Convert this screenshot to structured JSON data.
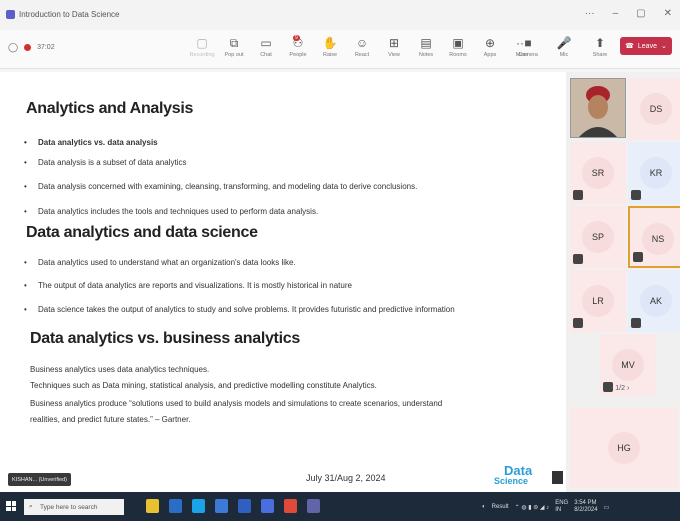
{
  "window": {
    "title": "Introduction to Data Science",
    "controls": [
      "···",
      "–",
      "▢",
      "✕"
    ]
  },
  "meeting": {
    "timer": "37:02",
    "tools": [
      {
        "name": "recording-icon",
        "glyph": "▢",
        "label": "Recording"
      },
      {
        "name": "pop-out-icon",
        "glyph": "⧉",
        "label": "Pop out"
      },
      {
        "name": "chat-icon",
        "glyph": "▭",
        "label": "Chat"
      },
      {
        "name": "people-icon",
        "glyph": "⚇",
        "label": "People"
      },
      {
        "name": "raise-hand-icon",
        "glyph": "✋",
        "label": "Raise"
      },
      {
        "name": "react-icon",
        "glyph": "☺",
        "label": "React"
      },
      {
        "name": "view-icon",
        "glyph": "⊞",
        "label": "View"
      },
      {
        "name": "notes-icon",
        "glyph": "▤",
        "label": "Notes"
      },
      {
        "name": "rooms-icon",
        "glyph": "▣",
        "label": "Rooms"
      },
      {
        "name": "apps-icon",
        "glyph": "⊕",
        "label": "Apps"
      },
      {
        "name": "more-icon",
        "glyph": "···",
        "label": "More"
      }
    ],
    "people_badge": "9",
    "right_tools": [
      {
        "name": "camera-icon",
        "glyph": "■",
        "label": "Camera"
      },
      {
        "name": "mic-icon",
        "glyph": "🎤",
        "label": "Mic"
      },
      {
        "name": "share-icon",
        "glyph": "⬆",
        "label": "Share"
      }
    ],
    "leave_label": "Leave",
    "leave_icon": "☎"
  },
  "slide": {
    "h1": "Analytics  and Analysis",
    "bullets1": [
      "Data analytics vs. data analysis",
      "Data analysis is a subset of data analytics",
      "Data analysis concerned with examining, cleansing, transforming, and modeling data to derive conclusions.",
      "Data analytics includes the tools and techniques used to perform data analysis."
    ],
    "h2": "Data analytics and data science",
    "bullets2": [
      "Data analytics used to understand what an organization's data looks like.",
      "The output of data analytics are reports and visualizations.   It is mostly historical in nature",
      "Data science takes the output of analytics to study and solve problems. It provides futuristic and predictive information"
    ],
    "h3": "Data analytics vs. business analytics",
    "paras": [
      "Business analytics uses data analytics techniques.",
      "Techniques such as Data mining, statistical analysis, and predictive modelling constitute Analytics.",
      "Business analytics produce “solutions used to build analysis models and simulations to create scenarios, understand",
      "realities, and predict future states.” – Gartner."
    ],
    "date": "July 31/Aug 2, 2024",
    "presenter_tag": "KISHAN... (Unverified)",
    "logo_top": "Data",
    "logo_bottom": "Science"
  },
  "participants": [
    {
      "initials": "DS"
    },
    {
      "initials": "SR"
    },
    {
      "initials": "KR"
    },
    {
      "initials": "SP"
    },
    {
      "initials": "NS"
    },
    {
      "initials": "LR"
    },
    {
      "initials": "AK"
    },
    {
      "initials": "MV"
    },
    {
      "initials": "HG"
    }
  ],
  "pager": "1/2",
  "taskbar": {
    "search_placeholder": "Type here to search",
    "tray_lang": "ENG",
    "tray_region": "IN",
    "time": "3:54 PM",
    "date": "8/2/2024",
    "weather": "Result"
  }
}
